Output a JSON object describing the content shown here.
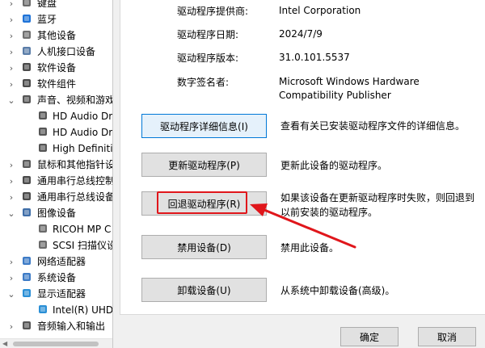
{
  "device_tree": {
    "items": [
      {
        "label": "键盘",
        "icon": "keyboard-icon",
        "state": "collapsed"
      },
      {
        "label": "蓝牙",
        "icon": "bluetooth-icon",
        "state": "collapsed"
      },
      {
        "label": "其他设备",
        "icon": "unknown-device-icon",
        "state": "collapsed"
      },
      {
        "label": "人机接口设备",
        "icon": "hid-icon",
        "state": "collapsed"
      },
      {
        "label": "软件设备",
        "icon": "software-device-icon",
        "state": "collapsed"
      },
      {
        "label": "软件组件",
        "icon": "software-component-icon",
        "state": "collapsed"
      },
      {
        "label": "声音、视频和游戏控制器",
        "icon": "speaker-icon",
        "state": "expanded"
      },
      {
        "label": "HD Audio Driver",
        "icon": "speaker-icon",
        "state": "child"
      },
      {
        "label": "HD Audio Driver",
        "icon": "speaker-icon",
        "state": "child"
      },
      {
        "label": "High Definition Audio",
        "icon": "speaker-icon",
        "state": "child"
      },
      {
        "label": "鼠标和其他指针设备",
        "icon": "mouse-icon",
        "state": "collapsed"
      },
      {
        "label": "通用串行总线控制器",
        "icon": "usb-icon",
        "state": "collapsed"
      },
      {
        "label": "通用串行总线设备",
        "icon": "usb-icon",
        "state": "collapsed"
      },
      {
        "label": "图像设备",
        "icon": "camera-icon",
        "state": "expanded"
      },
      {
        "label": "RICOH MP C",
        "icon": "scanner-icon",
        "state": "child"
      },
      {
        "label": "SCSI 扫描仪设备",
        "icon": "scanner-icon",
        "state": "child"
      },
      {
        "label": "网络适配器",
        "icon": "network-icon",
        "state": "collapsed"
      },
      {
        "label": "系统设备",
        "icon": "system-icon",
        "state": "collapsed"
      },
      {
        "label": "显示适配器",
        "icon": "monitor-icon",
        "state": "expanded"
      },
      {
        "label": "Intel(R) UHD Graphics",
        "icon": "monitor-icon",
        "state": "child"
      },
      {
        "label": "音频输入和输出",
        "icon": "audio-io-icon",
        "state": "collapsed"
      }
    ]
  },
  "driver_info": {
    "provider_label": "驱动程序提供商:",
    "provider_value": "Intel Corporation",
    "date_label": "驱动程序日期:",
    "date_value": "2024/7/9",
    "version_label": "驱动程序版本:",
    "version_value": "31.0.101.5537",
    "signer_label": "数字签名者:",
    "signer_value_line1": "Microsoft Windows Hardware",
    "signer_value_line2": "Compatibility Publisher"
  },
  "actions": {
    "details": {
      "label": "驱动程序详细信息(I)",
      "desc": "查看有关已安装驱动程序文件的详细信息。"
    },
    "update": {
      "label": "更新驱动程序(P)",
      "desc": "更新此设备的驱动程序。"
    },
    "rollback": {
      "label": "回退驱动程序(R)",
      "desc_line1": "如果该设备在更新驱动程序时失败，则回退到",
      "desc_line2": "以前安装的驱动程序。"
    },
    "disable": {
      "label": "禁用设备(D)",
      "desc": "禁用此设备。"
    },
    "uninstall": {
      "label": "卸载设备(U)",
      "desc": "从系统中卸载设备(高级)。"
    }
  },
  "footer": {
    "ok_label": "确定",
    "cancel_label": "取消"
  },
  "colors": {
    "annotation_red": "#e0161b",
    "focus_blue": "#0078d7"
  }
}
